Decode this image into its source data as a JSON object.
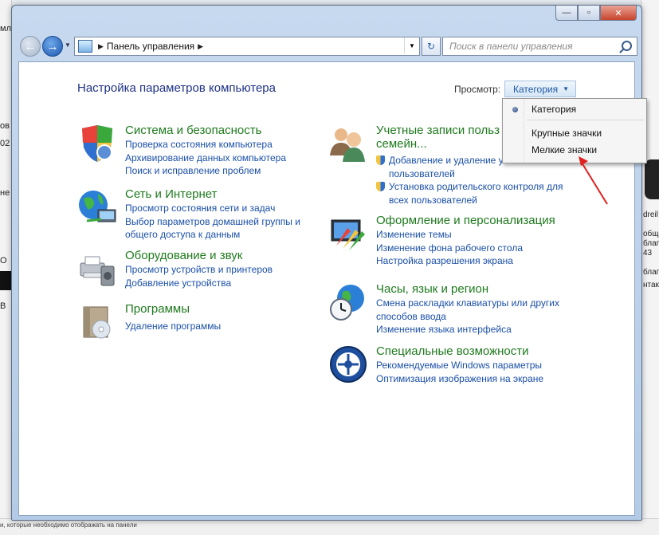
{
  "window": {
    "caption": {
      "minimize": "—",
      "maximize": "▫",
      "close": "✕"
    }
  },
  "navbar": {
    "address_path": [
      "Панель управления"
    ],
    "search_placeholder": "Поиск в панели управления"
  },
  "content": {
    "title": "Настройка параметров компьютера",
    "view_label": "Просмотр:",
    "view_value": "Категория",
    "categories_left": [
      {
        "icon": "security-shield-icon",
        "title": "Система и безопасность",
        "links": [
          "Проверка состояния компьютера",
          "Архивирование данных компьютера",
          "Поиск и исправление проблем"
        ]
      },
      {
        "icon": "network-globe-icon",
        "title": "Сеть и Интернет",
        "links": [
          "Просмотр состояния сети и задач",
          "Выбор параметров домашней группы и",
          "общего доступа к данным"
        ]
      },
      {
        "icon": "printer-hardware-icon",
        "title": "Оборудование и звук",
        "links": [
          "Просмотр устройств и принтеров",
          "Добавление устройства"
        ]
      },
      {
        "icon": "programs-box-icon",
        "title": "Программы",
        "links": [
          "Удаление программы"
        ]
      }
    ],
    "categories_right": [
      {
        "icon": "user-accounts-icon",
        "title_line1": "Учетные записи польз",
        "title_line2": "семейн...",
        "links": [
          "Добавление и удаление уч",
          "пользователей",
          "Установка родительского контроля для",
          "всех пользователей"
        ]
      },
      {
        "icon": "personalization-icon",
        "title": "Оформление и персонализация",
        "links": [
          "Изменение темы",
          "Изменение фона рабочего стола",
          "Настройка разрешения экрана"
        ]
      },
      {
        "icon": "clock-globe-icon",
        "title": "Часы, язык и регион",
        "links": [
          "Смена раскладки клавиатуры или других",
          "способов ввода",
          "Изменение языка интерфейса"
        ]
      },
      {
        "icon": "accessibility-icon",
        "title": "Специальные возможности",
        "links": [
          "Рекомендуемые Windows параметры",
          "Оптимизация изображения на экране"
        ]
      }
    ]
  },
  "view_menu": {
    "items": [
      "Категория",
      "Крупные значки",
      "Мелкие значки"
    ],
    "selected": "Категория"
  },
  "background": {
    "left_fragments": [
      "мли",
      "ов",
      "02",
      "не",
      "О",
      "В"
    ],
    "right_fragments": [
      "dreil",
      "обще",
      "благо",
      "43",
      "благо",
      "нтакт"
    ],
    "bottom_text": "и, которые необходимо отображать на панели"
  },
  "colors": {
    "link": "#1a4fa8",
    "category_title": "#1e7a1e",
    "page_title": "#1e3287",
    "annotation_arrow": "#e02020"
  }
}
